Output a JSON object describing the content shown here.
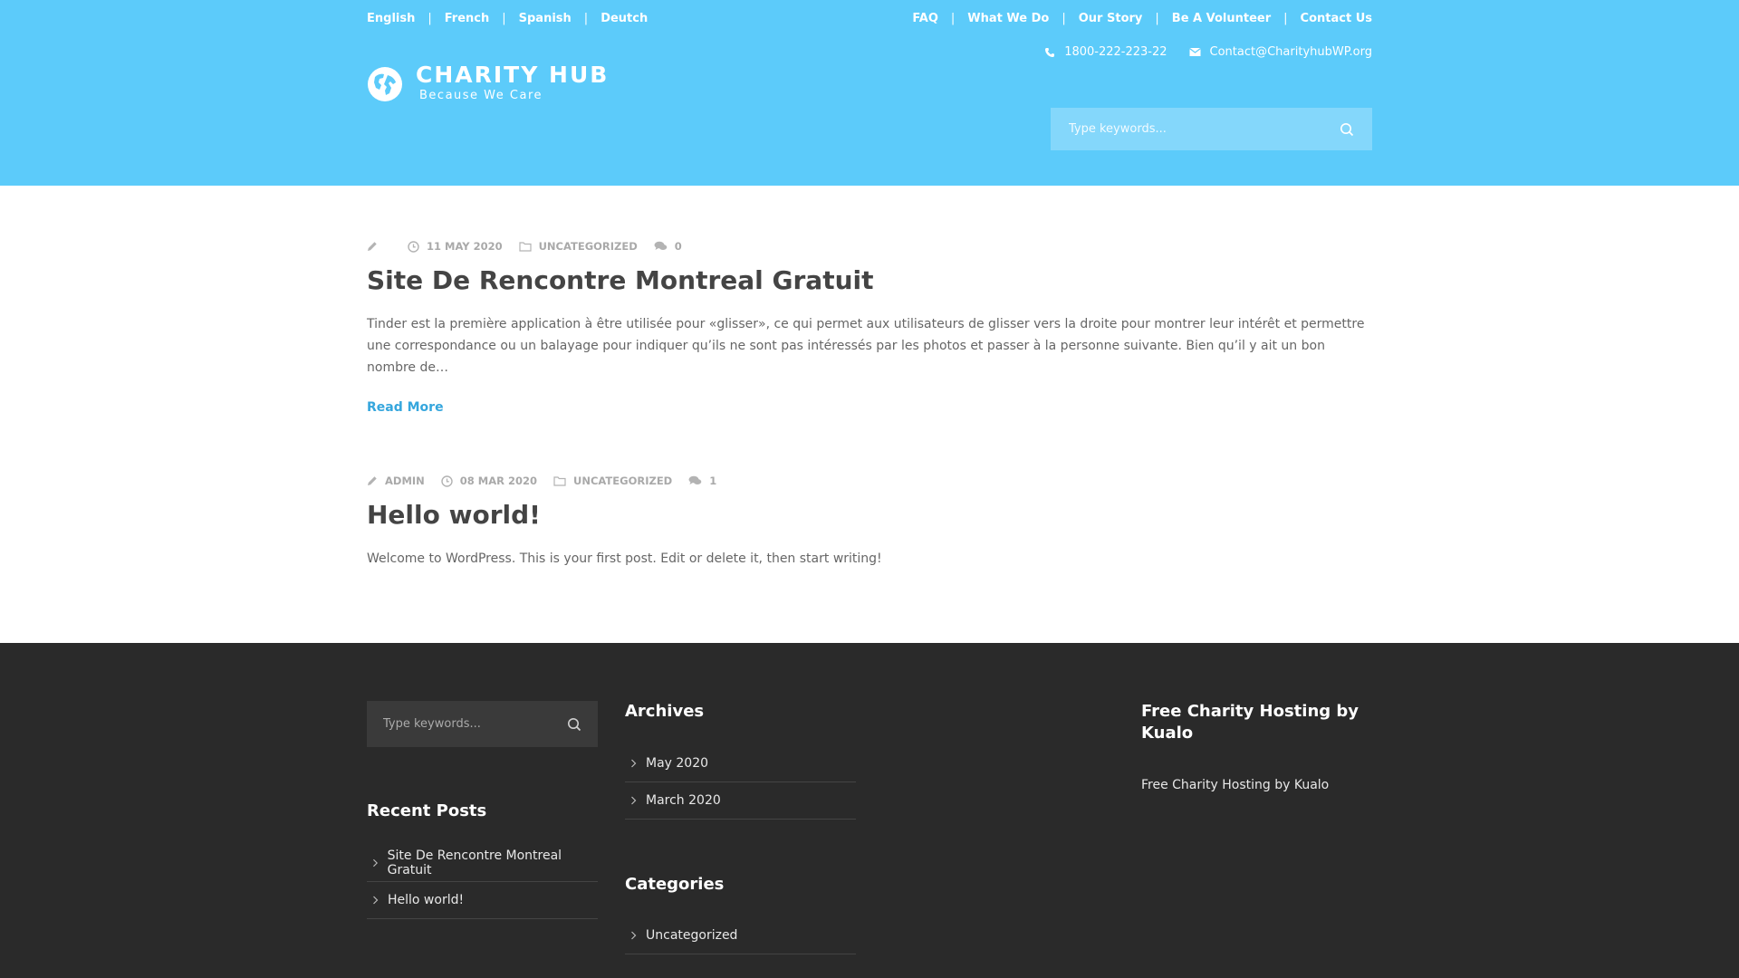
{
  "header": {
    "languages": [
      "English",
      "French",
      "Spanish",
      "Deutch"
    ],
    "nav": [
      "FAQ",
      "What We Do",
      "Our Story",
      "Be A Volunteer",
      "Contact Us"
    ],
    "phone": "1800-222-223-22",
    "email": "Contact@CharityhubWP.org",
    "brand": "CHARITY HUB",
    "tagline": "Because We Care",
    "search_placeholder": "Type keywords..."
  },
  "posts": [
    {
      "author": "",
      "date": "11 MAY 2020",
      "category": "UNCATEGORIZED",
      "comments": "0",
      "title": "Site De Rencontre Montreal Gratuit",
      "excerpt": "Tinder est la première application à être utilisée pour «glisser», ce qui permet aux utilisateurs de glisser vers la droite pour montrer leur intérêt et permettre une correspondance ou un balayage pour indiquer qu’ils ne sont pas intéressés par les photos et passer à la personne suivante. Bien qu’il y ait un bon nombre de…",
      "read_more": "Read More"
    },
    {
      "author": "ADMIN",
      "date": "08 MAR 2020",
      "category": "UNCATEGORIZED",
      "comments": "1",
      "title": "Hello world!",
      "excerpt": "Welcome to WordPress. This is your first post. Edit or delete it, then start writing!"
    }
  ],
  "footer": {
    "search_placeholder": "Type keywords...",
    "archives_title": "Archives",
    "archives": [
      "May 2020",
      "March 2020"
    ],
    "recent_title": "Recent Posts",
    "recent": [
      "Site De Rencontre Montreal Gratuit",
      "Hello world!"
    ],
    "categories_title": "Categories",
    "categories": [
      "Uncategorized"
    ],
    "hosting_title": "Free Charity Hosting by Kualo",
    "hosting_text": "Free Charity Hosting by Kualo"
  },
  "colors": {
    "header_bg": "#5ccbfa",
    "accent": "#35a6dd",
    "footer_bg": "#2a2a2a"
  },
  "icons": [
    "pencil-icon",
    "clock-icon",
    "folder-icon",
    "comments-icon",
    "search-icon",
    "phone-icon",
    "envelope-icon",
    "globe-icon",
    "chevron-right-icon"
  ]
}
